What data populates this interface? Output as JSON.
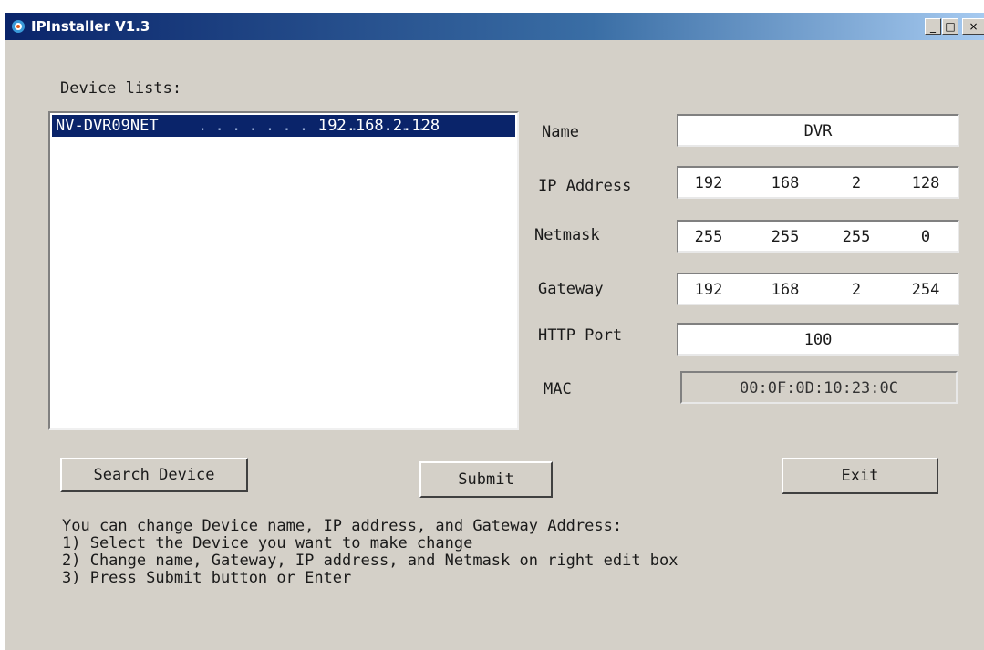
{
  "window": {
    "title": "IPInstaller V1.3",
    "controls": {
      "minimize": "_",
      "maximize": "□",
      "close": "×"
    }
  },
  "device_list": {
    "label": "Device lists:",
    "items": [
      {
        "name": "NV-DVR09NET",
        "ip": "192.168.2.128",
        "selected": true
      }
    ]
  },
  "form": {
    "name_label": "Name",
    "name_value": "DVR",
    "ip_label": "IP Address",
    "ip_octets": [
      "192",
      "168",
      "2",
      "128"
    ],
    "netmask_label": "Netmask",
    "netmask_octets": [
      "255",
      "255",
      "255",
      "0"
    ],
    "gateway_label": "Gateway",
    "gateway_octets": [
      "192",
      "168",
      "2",
      "254"
    ],
    "http_port_label": "HTTP Port",
    "http_port_value": "100",
    "mac_label": "MAC",
    "mac_value": "00:0F:0D:10:23:0C"
  },
  "buttons": {
    "search": "Search Device",
    "submit": "Submit",
    "exit": "Exit"
  },
  "instructions": [
    "You can change Device name, IP address, and Gateway Address:",
    "1) Select the Device you want to make change",
    "2) Change name, Gateway, IP address, and Netmask on right edit box",
    "3) Press Submit button or Enter"
  ],
  "colors": {
    "window_bg": "#d4d0c8",
    "titlebar_start": "#0a246a",
    "selection_bg": "#0a246a",
    "selection_fg": "#ffffff"
  }
}
